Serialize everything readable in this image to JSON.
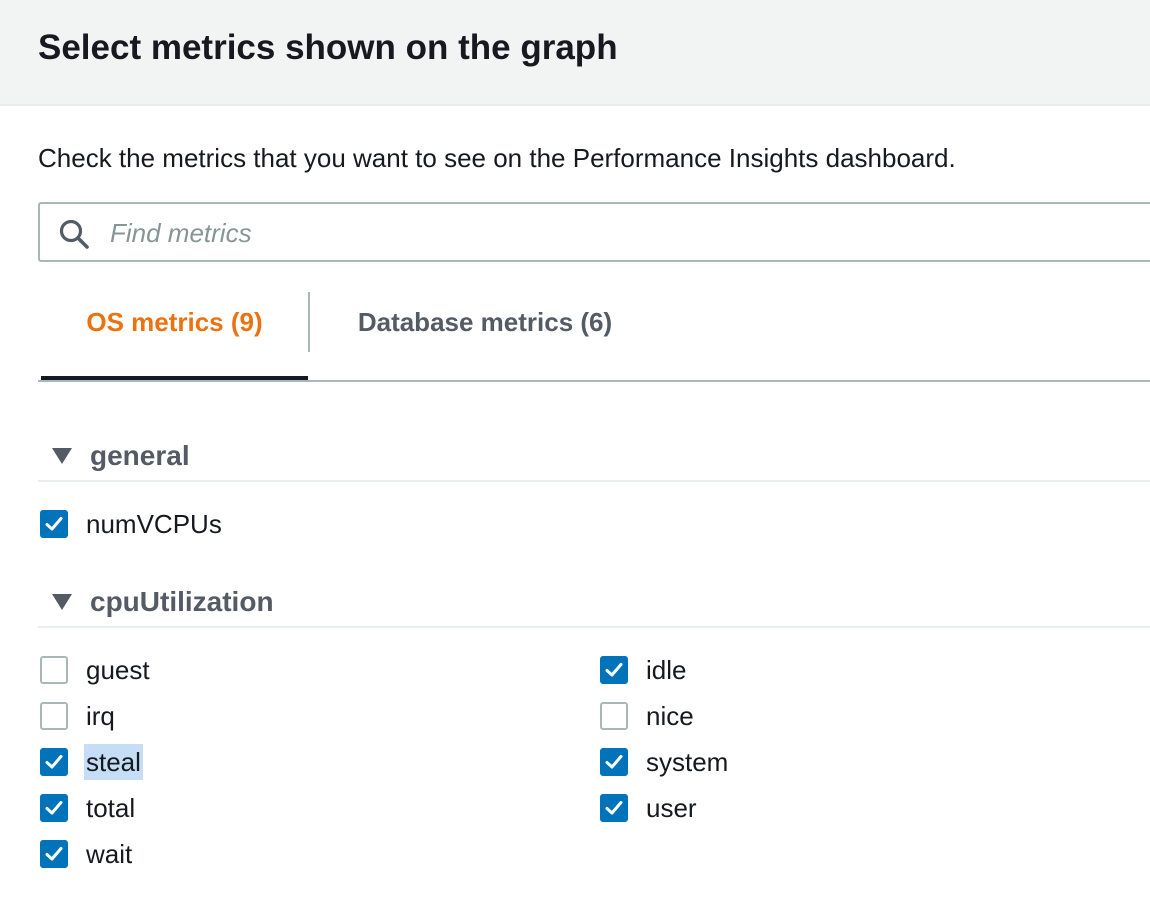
{
  "modal": {
    "title": "Select metrics shown on the graph",
    "description": "Check the metrics that you want to see on the Performance Insights dashboard."
  },
  "search": {
    "placeholder": "Find metrics",
    "value": "",
    "icon": "search-icon"
  },
  "tabs": [
    {
      "label": "OS metrics (9)",
      "active": true
    },
    {
      "label": "Database metrics (6)",
      "active": false
    }
  ],
  "colors": {
    "active_tab": "#ec7211",
    "checkbox_checked": "#0073bb",
    "selection_highlight": "#c6def5"
  },
  "sections": [
    {
      "title": "general",
      "icon": "caret-down-icon",
      "metrics": [
        {
          "label": "numVCPUs",
          "checked": true
        }
      ]
    },
    {
      "title": "cpuUtilization",
      "icon": "caret-down-icon",
      "metrics": [
        {
          "label": "guest",
          "checked": false
        },
        {
          "label": "idle",
          "checked": true
        },
        {
          "label": "irq",
          "checked": false
        },
        {
          "label": "nice",
          "checked": false
        },
        {
          "label": "steal",
          "checked": true,
          "selected_text": true
        },
        {
          "label": "system",
          "checked": true
        },
        {
          "label": "total",
          "checked": true
        },
        {
          "label": "user",
          "checked": true
        },
        {
          "label": "wait",
          "checked": true
        }
      ]
    }
  ]
}
